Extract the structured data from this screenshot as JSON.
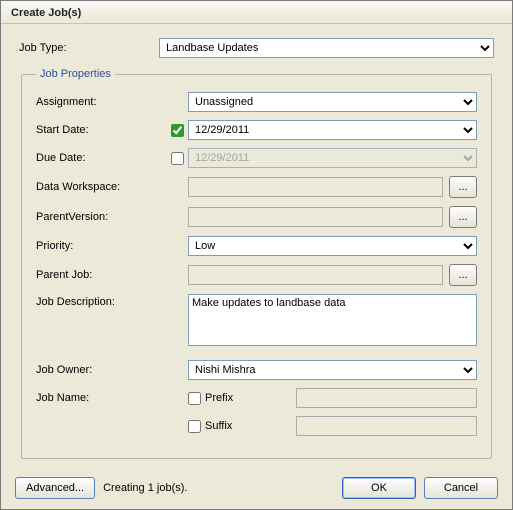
{
  "window": {
    "title": "Create Job(s)"
  },
  "jobType": {
    "label": "Job Type:",
    "value": "Landbase Updates"
  },
  "props": {
    "legend": "Job Properties",
    "assignment": {
      "label": "Assignment:",
      "value": "Unassigned"
    },
    "startDate": {
      "label": "Start Date:",
      "value": "12/29/2011",
      "checked": true
    },
    "dueDate": {
      "label": "Due Date:",
      "value": "12/29/2011",
      "checked": false
    },
    "dataWorkspace": {
      "label": "Data Workspace:",
      "browse": "..."
    },
    "parentVersion": {
      "label": "ParentVersion:",
      "browse": "..."
    },
    "priority": {
      "label": "Priority:",
      "value": "Low"
    },
    "parentJob": {
      "label": "Parent Job:",
      "browse": "..."
    },
    "description": {
      "label": "Job Description:",
      "value": "Make updates to landbase data"
    },
    "owner": {
      "label": "Job Owner:",
      "value": "Nishi Mishra"
    },
    "jobName": {
      "label": "Job Name:",
      "prefix": {
        "label": "Prefix",
        "checked": false
      },
      "suffix": {
        "label": "Suffix",
        "checked": false
      }
    }
  },
  "footer": {
    "advanced": "Advanced...",
    "status": "Creating 1 job(s).",
    "ok": "OK",
    "cancel": "Cancel"
  }
}
